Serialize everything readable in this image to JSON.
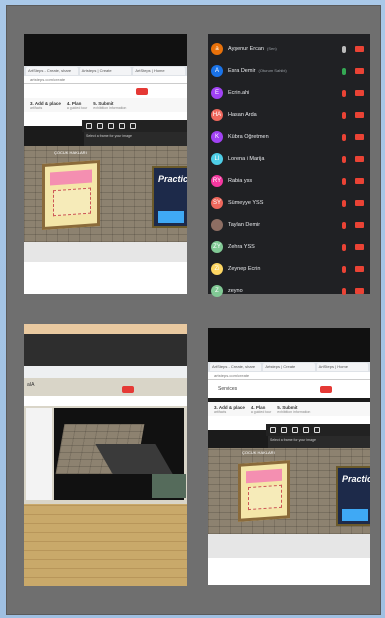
{
  "browser": {
    "tab_labels": [
      "ArtSteps - Create, share",
      "Artsteps | Create",
      "ArtSteps | Home"
    ],
    "url": "artsteps.com/create"
  },
  "steps": [
    {
      "label": "3. Add & place",
      "sub": "artifacts"
    },
    {
      "label": "4. Plan",
      "sub": "a guided tour"
    },
    {
      "label": "5. Submit",
      "sub": "exhibition information"
    }
  ],
  "toolbar_hint": "Select a frame for your image",
  "poster_title": "ÇOCUK HAKLARI",
  "practice_text": "Practic",
  "left_label": "aIA",
  "menu_label": "Services",
  "participants": [
    {
      "initial": "a",
      "name": "Ayşenur Ercan",
      "note": "(Sen)",
      "color": "#e8710a",
      "mic": "on",
      "cam": false
    },
    {
      "initial": "A",
      "name": "Esra Demir",
      "note": "(Oturum Sahibi)",
      "color": "#1a73e8",
      "mic": "green",
      "cam": false
    },
    {
      "initial": "E",
      "name": "Ecrin.ahi",
      "note": "",
      "color": "#a142f4",
      "mic": "off",
      "cam": true
    },
    {
      "initial": "HA",
      "name": "Hasan Arda",
      "note": "",
      "color": "#ee675c",
      "mic": "off",
      "cam": true
    },
    {
      "initial": "K",
      "name": "Kübra Öğretmen",
      "note": "",
      "color": "#a142f4",
      "mic": "off",
      "cam": true
    },
    {
      "initial": "LI",
      "name": "Lorena i Marija",
      "note": "",
      "color": "#4ecde6",
      "mic": "off",
      "cam": true
    },
    {
      "initial": "RY",
      "name": "Rabia yss",
      "note": "",
      "color": "#f538a0",
      "mic": "off",
      "cam": true
    },
    {
      "initial": "SY",
      "name": "Sümeyye YSS",
      "note": "",
      "color": "#ee675c",
      "mic": "off",
      "cam": true
    },
    {
      "initial": "",
      "name": "Taylan Demir",
      "note": "",
      "color": "#8d6e63",
      "mic": "off",
      "cam": true
    },
    {
      "initial": "ZY",
      "name": "Zehra YSS",
      "note": "",
      "color": "#81c995",
      "mic": "off",
      "cam": true
    },
    {
      "initial": "Zi",
      "name": "Zeynep Ecrin",
      "note": "",
      "color": "#fdd663",
      "mic": "off",
      "cam": true
    },
    {
      "initial": "Z",
      "name": "zeyno",
      "note": "",
      "color": "#81c995",
      "mic": "off",
      "cam": true
    }
  ]
}
